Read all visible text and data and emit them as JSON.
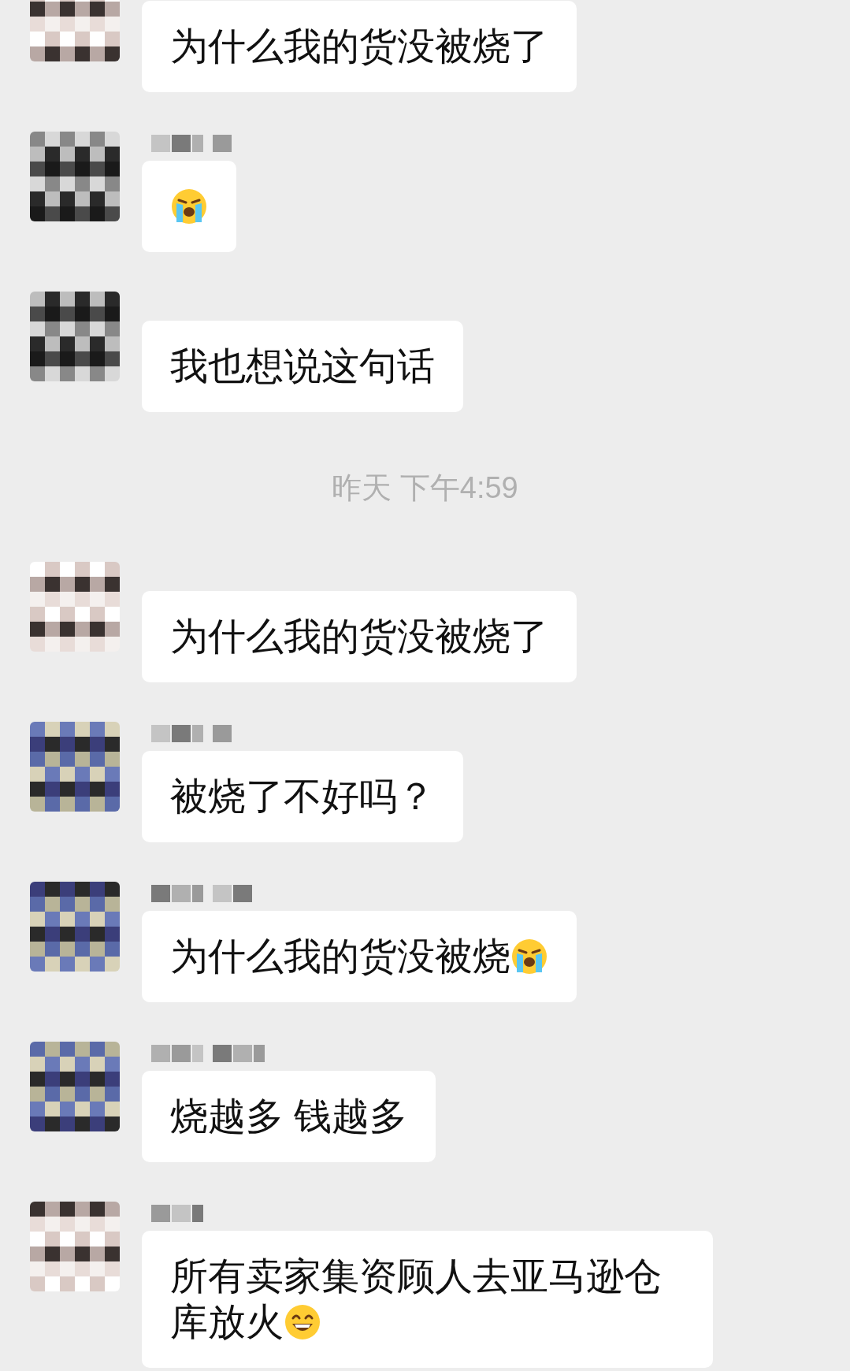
{
  "items": [
    {
      "kind": "message",
      "name_redacted": false,
      "parts": [
        {
          "kind": "text",
          "text": "为什么我的货没被烧了"
        }
      ]
    },
    {
      "kind": "message",
      "name_redacted": true,
      "parts": [
        {
          "kind": "cry"
        }
      ]
    },
    {
      "kind": "message",
      "name_redacted": false,
      "parts": [
        {
          "kind": "text",
          "text": "我也想说这句话"
        }
      ]
    },
    {
      "kind": "time",
      "text": "昨天 下午4:59"
    },
    {
      "kind": "message",
      "name_redacted": false,
      "parts": [
        {
          "kind": "text",
          "text": "为什么我的货没被烧了"
        }
      ]
    },
    {
      "kind": "message",
      "name_redacted": true,
      "parts": [
        {
          "kind": "text",
          "text": "被烧了不好吗？"
        }
      ]
    },
    {
      "kind": "message",
      "name_redacted": true,
      "parts": [
        {
          "kind": "text",
          "text": "为什么我的货没被烧"
        },
        {
          "kind": "cry"
        }
      ]
    },
    {
      "kind": "message",
      "name_redacted": true,
      "parts": [
        {
          "kind": "text",
          "text": "烧越多 钱越多"
        }
      ]
    },
    {
      "kind": "message",
      "name_redacted": true,
      "parts": [
        {
          "kind": "text",
          "text": "所有卖家集资顾人去亚马逊仓库放火"
        },
        {
          "kind": "grin"
        }
      ]
    }
  ]
}
